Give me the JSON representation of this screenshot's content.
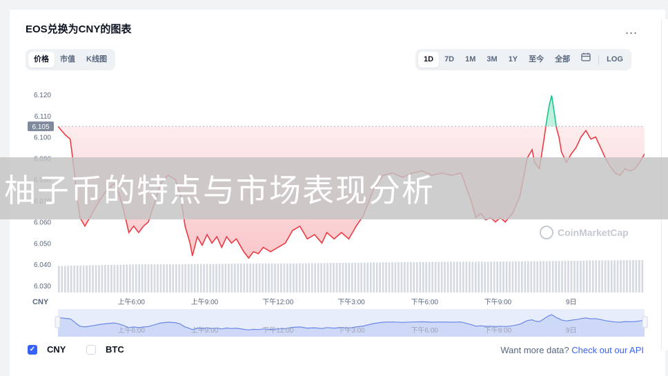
{
  "header": {
    "title": "EOS兑换为CNY的图表",
    "more": "..."
  },
  "type_tabs": [
    {
      "label": "价格",
      "active": true
    },
    {
      "label": "市值",
      "active": false
    },
    {
      "label": "K线图",
      "active": false
    }
  ],
  "range_tabs": [
    {
      "label": "1D",
      "active": true
    },
    {
      "label": "7D",
      "active": false
    },
    {
      "label": "1M",
      "active": false
    },
    {
      "label": "3M",
      "active": false
    },
    {
      "label": "1Y",
      "active": false
    },
    {
      "label": "至今",
      "active": false
    },
    {
      "label": "全部",
      "active": false
    },
    {
      "label": "calendar-icon",
      "active": false,
      "icon": true
    },
    {
      "label": "LOG",
      "active": false
    }
  ],
  "currency_toggle": {
    "cny": "CNY",
    "btc": "BTC",
    "cny_checked": true,
    "btc_checked": false
  },
  "api_note": {
    "text": "Want more data?",
    "link": "Check out our API"
  },
  "watermark": "CoinMarketCap",
  "banner_text": "柚子币的特点与市场表现分析",
  "colors": {
    "up": "#16c784",
    "down": "#ea3943",
    "accent": "#3861fb"
  },
  "chart_data": {
    "type": "area",
    "reference_price": 6.105,
    "reference_label": "6.105",
    "y_axis_label": "CNY",
    "y_ticks": [
      "6.120",
      "6.110",
      "6.100",
      "6.090",
      "6.080",
      "6.070",
      "6.060",
      "6.050",
      "6.040",
      "6.030"
    ],
    "y_tick_values": [
      6.12,
      6.11,
      6.1,
      6.09,
      6.08,
      6.07,
      6.06,
      6.05,
      6.04,
      6.03
    ],
    "ylim": [
      6.03,
      6.12
    ],
    "x_ticks": [
      "上午6:00",
      "上午9:00",
      "下午12:00",
      "下午3:00",
      "下午6:00",
      "下午9:00",
      "9日"
    ],
    "x_tick_hours": [
      3,
      6,
      9,
      12,
      15,
      18,
      21
    ],
    "x_range_hours": [
      0,
      24
    ],
    "price_series": [
      [
        0.0,
        6.105
      ],
      [
        0.3,
        6.101
      ],
      [
        0.5,
        6.099
      ],
      [
        0.6,
        6.09
      ],
      [
        0.8,
        6.07
      ],
      [
        0.9,
        6.062
      ],
      [
        1.1,
        6.058
      ],
      [
        1.4,
        6.064
      ],
      [
        1.7,
        6.07
      ],
      [
        2.0,
        6.075
      ],
      [
        2.3,
        6.078
      ],
      [
        2.5,
        6.073
      ],
      [
        2.7,
        6.065
      ],
      [
        2.9,
        6.055
      ],
      [
        3.1,
        6.058
      ],
      [
        3.3,
        6.055
      ],
      [
        3.5,
        6.058
      ],
      [
        3.7,
        6.06
      ],
      [
        3.9,
        6.067
      ],
      [
        4.2,
        6.078
      ],
      [
        4.5,
        6.082
      ],
      [
        4.8,
        6.08
      ],
      [
        5.0,
        6.073
      ],
      [
        5.2,
        6.058
      ],
      [
        5.4,
        6.05
      ],
      [
        5.5,
        6.044
      ],
      [
        5.7,
        6.053
      ],
      [
        5.9,
        6.049
      ],
      [
        6.1,
        6.054
      ],
      [
        6.3,
        6.05
      ],
      [
        6.5,
        6.053
      ],
      [
        6.7,
        6.048
      ],
      [
        6.9,
        6.053
      ],
      [
        7.1,
        6.05
      ],
      [
        7.3,
        6.052
      ],
      [
        7.6,
        6.046
      ],
      [
        7.8,
        6.043
      ],
      [
        8.0,
        6.046
      ],
      [
        8.2,
        6.045
      ],
      [
        8.4,
        6.048
      ],
      [
        8.7,
        6.046
      ],
      [
        9.0,
        6.048
      ],
      [
        9.3,
        6.05
      ],
      [
        9.6,
        6.056
      ],
      [
        9.9,
        6.058
      ],
      [
        10.2,
        6.052
      ],
      [
        10.5,
        6.054
      ],
      [
        10.8,
        6.05
      ],
      [
        11.0,
        6.055
      ],
      [
        11.3,
        6.052
      ],
      [
        11.6,
        6.055
      ],
      [
        11.9,
        6.052
      ],
      [
        12.2,
        6.058
      ],
      [
        12.5,
        6.063
      ],
      [
        12.9,
        6.075
      ],
      [
        13.3,
        6.082
      ],
      [
        13.7,
        6.083
      ],
      [
        14.1,
        6.081
      ],
      [
        14.5,
        6.083
      ],
      [
        14.9,
        6.084
      ],
      [
        15.3,
        6.082
      ],
      [
        15.7,
        6.083
      ],
      [
        16.1,
        6.082
      ],
      [
        16.5,
        6.083
      ],
      [
        16.9,
        6.07
      ],
      [
        17.1,
        6.062
      ],
      [
        17.3,
        6.064
      ],
      [
        17.5,
        6.061
      ],
      [
        17.7,
        6.062
      ],
      [
        17.9,
        6.06
      ],
      [
        18.1,
        6.062
      ],
      [
        18.3,
        6.06
      ],
      [
        18.6,
        6.064
      ],
      [
        18.9,
        6.072
      ],
      [
        19.2,
        6.09
      ],
      [
        19.4,
        6.094
      ],
      [
        19.5,
        6.088
      ],
      [
        19.7,
        6.085
      ],
      [
        19.9,
        6.1
      ],
      [
        20.0,
        6.108
      ],
      [
        20.1,
        6.115
      ],
      [
        20.2,
        6.1195
      ],
      [
        20.3,
        6.112
      ],
      [
        20.4,
        6.104
      ],
      [
        20.5,
        6.1
      ],
      [
        20.6,
        6.093
      ],
      [
        20.8,
        6.088
      ],
      [
        21.0,
        6.092
      ],
      [
        21.2,
        6.095
      ],
      [
        21.4,
        6.1
      ],
      [
        21.6,
        6.103
      ],
      [
        21.8,
        6.099
      ],
      [
        22.0,
        6.1
      ],
      [
        22.2,
        6.095
      ],
      [
        22.4,
        6.09
      ],
      [
        22.6,
        6.086
      ],
      [
        22.8,
        6.083
      ],
      [
        23.0,
        6.082
      ],
      [
        23.2,
        6.085
      ],
      [
        23.4,
        6.084
      ],
      [
        23.6,
        6.085
      ],
      [
        23.8,
        6.088
      ],
      [
        24.0,
        6.092
      ]
    ],
    "volume_relative": [
      0.62,
      0.64,
      0.66,
      0.66,
      0.67,
      0.68,
      0.68,
      0.69,
      0.7,
      0.71,
      0.72,
      0.72,
      0.73,
      0.74,
      0.75,
      0.76
    ]
  }
}
